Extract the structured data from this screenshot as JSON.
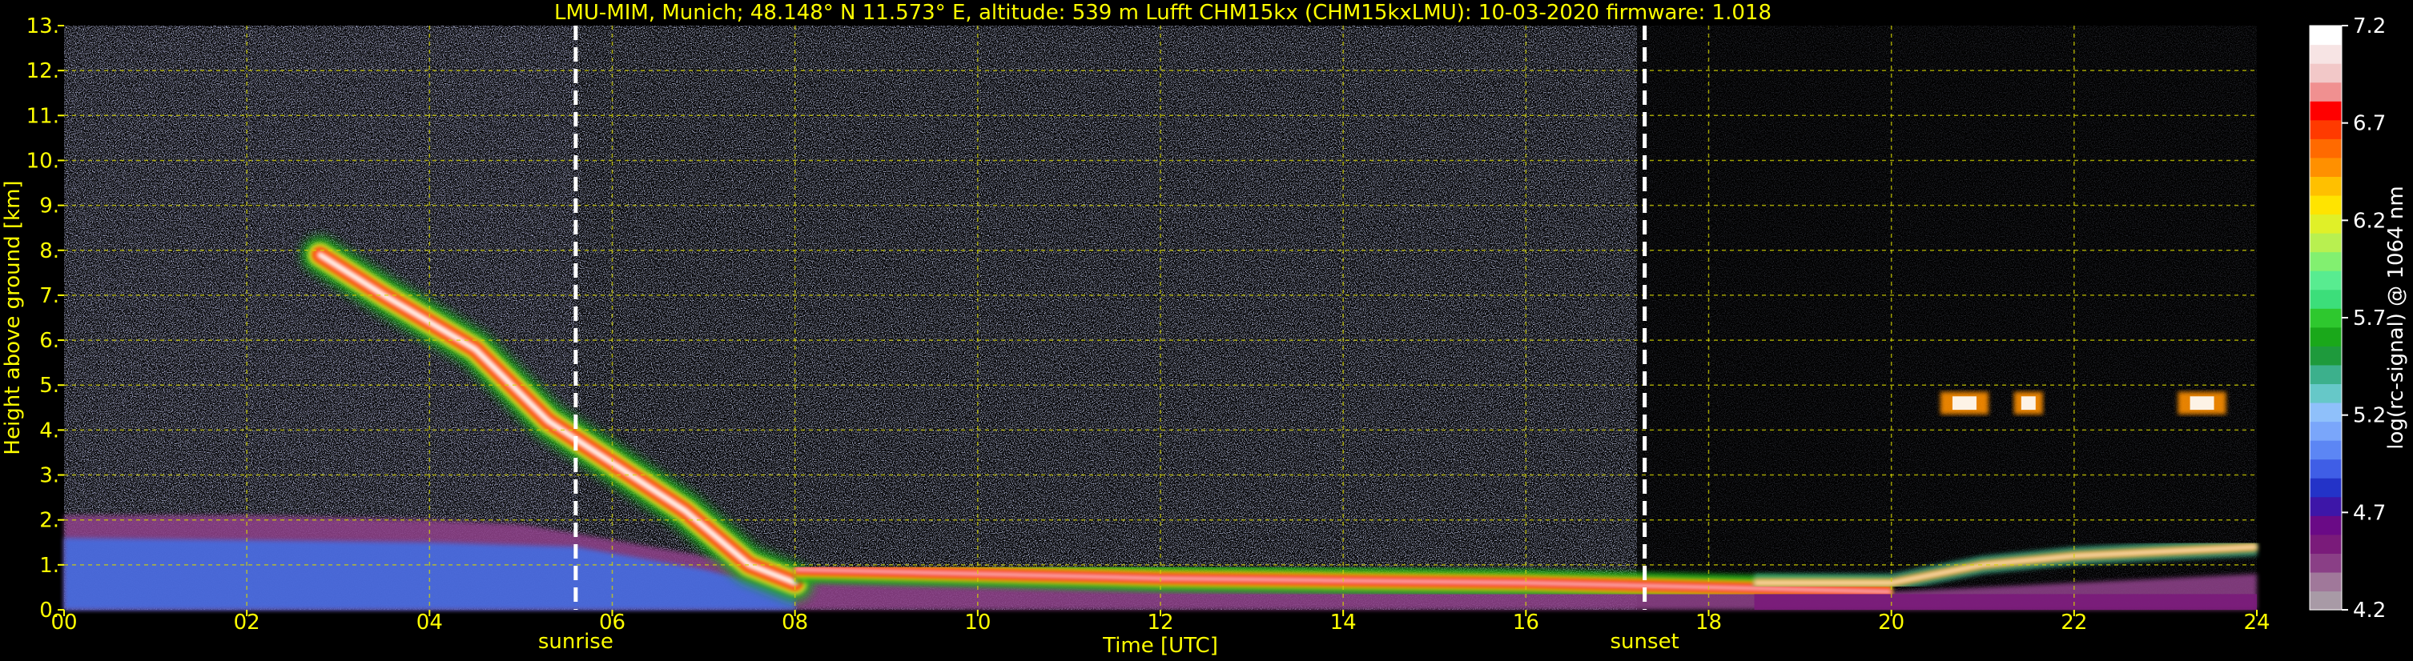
{
  "chart_data": {
    "type": "heatmap",
    "title": "LMU-MIM, Munich; 48.148° N 11.573° E, altitude: 539 m    Lufft CHM15kx (CHM15kxLMU): 10-03-2020    firmware: 1.018",
    "xlabel": "Time [UTC]",
    "ylabel": "Height above ground [km]",
    "x_ticks": [
      "00",
      "02",
      "04",
      "06",
      "08",
      "10",
      "12",
      "14",
      "16",
      "18",
      "20",
      "22",
      "24"
    ],
    "y_ticks": [
      "0.",
      "1.",
      "2.",
      "3.",
      "4.",
      "5.",
      "6.",
      "7.",
      "8.",
      "9.",
      "10.",
      "11.",
      "12.",
      "13."
    ],
    "xlim": [
      0,
      24
    ],
    "ylim": [
      0,
      13
    ],
    "grid": true,
    "colorbar": {
      "label": "log(rc-signal) @ 1064 nm",
      "ticks": [
        "4.2",
        "4.7",
        "5.2",
        "5.7",
        "6.2",
        "6.7",
        "7.2"
      ],
      "range": [
        4.2,
        7.2
      ],
      "colors": [
        "#a89aa6",
        "#a0789a",
        "#8a3f86",
        "#7a1b7a",
        "#6a0a86",
        "#3d16a8",
        "#2333c8",
        "#3f5ee6",
        "#5c86f4",
        "#7aa6fa",
        "#8fc0fa",
        "#66c8c8",
        "#3cb08c",
        "#1e9a3c",
        "#1aa81a",
        "#2ec82e",
        "#3cde7a",
        "#58ec90",
        "#82f070",
        "#b8f050",
        "#e0f028",
        "#ffe400",
        "#ffc000",
        "#ff9000",
        "#ff6a00",
        "#ff3a00",
        "#ff0000",
        "#f09090",
        "#f2c8c8",
        "#f7e4e4",
        "#ffffff"
      ]
    },
    "annotations": [
      {
        "text": "sunrise",
        "x": 5.6
      },
      {
        "text": "sunset",
        "x": 17.3
      }
    ],
    "layers": [
      {
        "name": "boundary layer / aerosol",
        "points": [
          [
            0,
            2.1
          ],
          [
            2,
            2.1
          ],
          [
            4,
            2.0
          ],
          [
            5,
            1.9
          ],
          [
            5.6,
            1.7
          ],
          [
            7,
            1.2
          ],
          [
            8,
            0.9
          ],
          [
            12,
            0.7
          ],
          [
            16,
            0.6
          ],
          [
            18,
            0.5
          ],
          [
            20,
            0.4
          ],
          [
            22,
            0.6
          ],
          [
            24,
            0.8
          ]
        ]
      },
      {
        "name": "descending cloud",
        "points": [
          [
            2.8,
            7.9
          ],
          [
            3.5,
            7.0
          ],
          [
            4.5,
            5.8
          ],
          [
            5.3,
            4.2
          ],
          [
            6.2,
            3.0
          ],
          [
            6.8,
            2.2
          ],
          [
            7.5,
            1.0
          ],
          [
            8,
            0.6
          ]
        ]
      },
      {
        "name": "mid-level cloud",
        "points": [
          [
            20.8,
            4.6
          ],
          [
            21.5,
            4.6
          ],
          [
            23.4,
            4.6
          ]
        ]
      },
      {
        "name": "low cloud",
        "points": [
          [
            18.5,
            0.6
          ],
          [
            20,
            0.6
          ],
          [
            21,
            1.0
          ],
          [
            22,
            1.2
          ],
          [
            24,
            1.4
          ]
        ]
      }
    ]
  }
}
